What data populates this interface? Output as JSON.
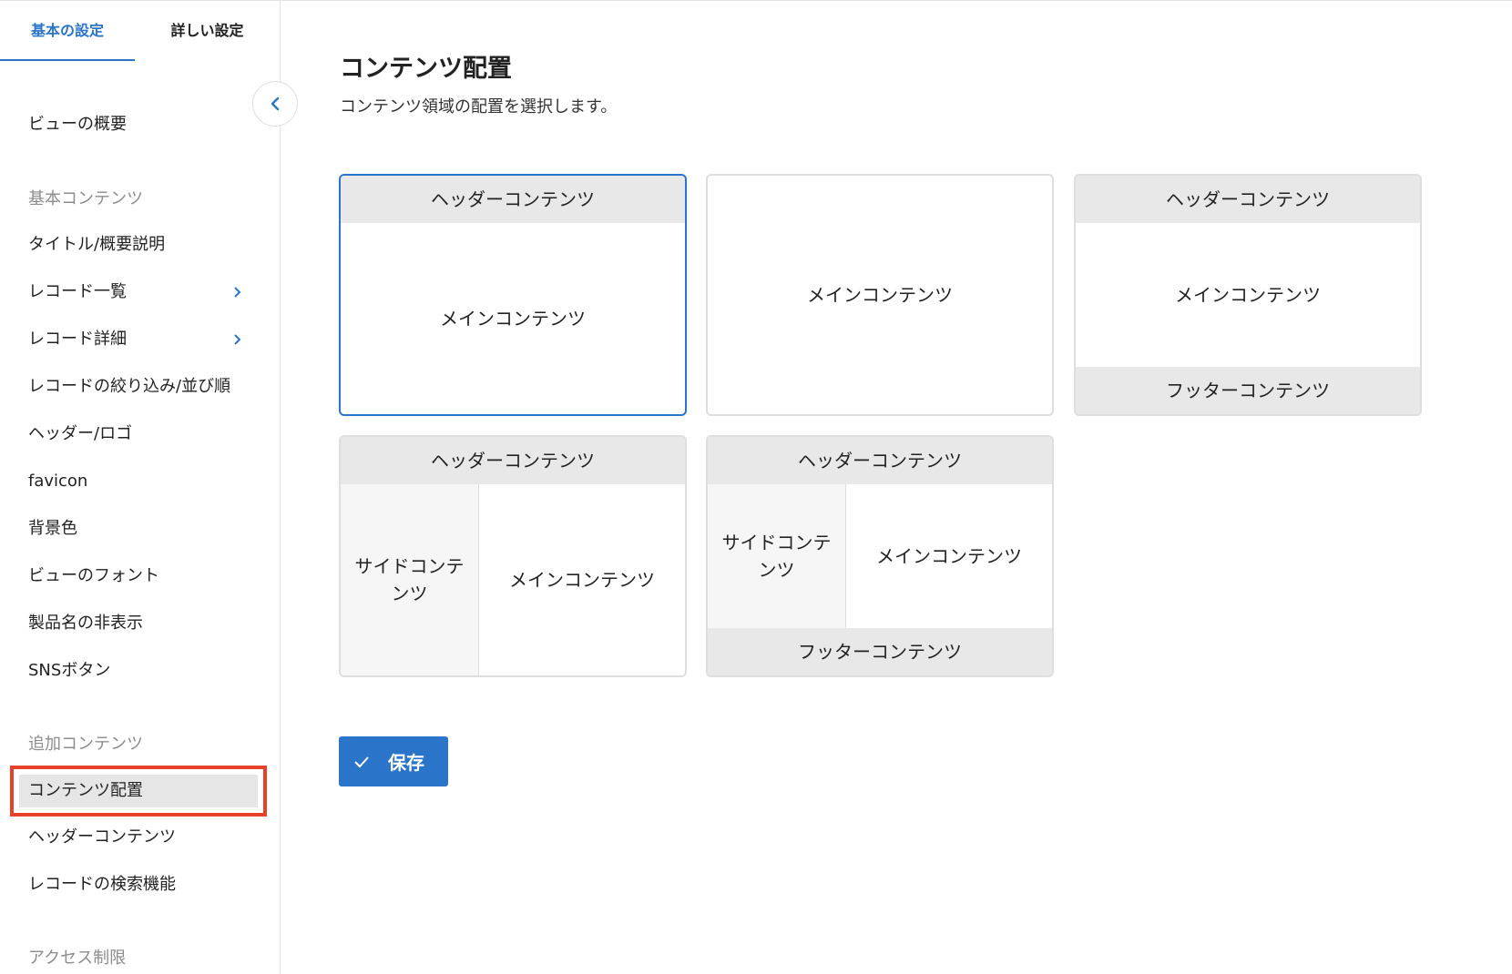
{
  "tabs": {
    "basic": "基本の設定",
    "advanced": "詳しい設定"
  },
  "sidebar": {
    "overview": "ビューの概要",
    "section_basic": "基本コンテンツ",
    "title_desc": "タイトル/概要説明",
    "record_list": "レコード一覧",
    "record_detail": "レコード詳細",
    "record_filter": "レコードの絞り込み/並び順",
    "header_logo": "ヘッダー/ロゴ",
    "favicon": "favicon",
    "bg_color": "背景色",
    "view_font": "ビューのフォント",
    "hide_product": "製品名の非表示",
    "sns_button": "SNSボタン",
    "section_additional": "追加コンテンツ",
    "content_layout": "コンテンツ配置",
    "header_content": "ヘッダーコンテンツ",
    "record_search": "レコードの検索機能",
    "section_access": "アクセス制限"
  },
  "main": {
    "title": "コンテンツ配置",
    "description": "コンテンツ領域の配置を選択します。",
    "save_label": "保存"
  },
  "layouts": {
    "header": "ヘッダーコンテンツ",
    "main": "メインコンテンツ",
    "footer": "フッターコンテンツ",
    "side": "サイドコンテンツ"
  },
  "colors": {
    "accent": "#2a74c9",
    "highlight": "#e8412b"
  }
}
